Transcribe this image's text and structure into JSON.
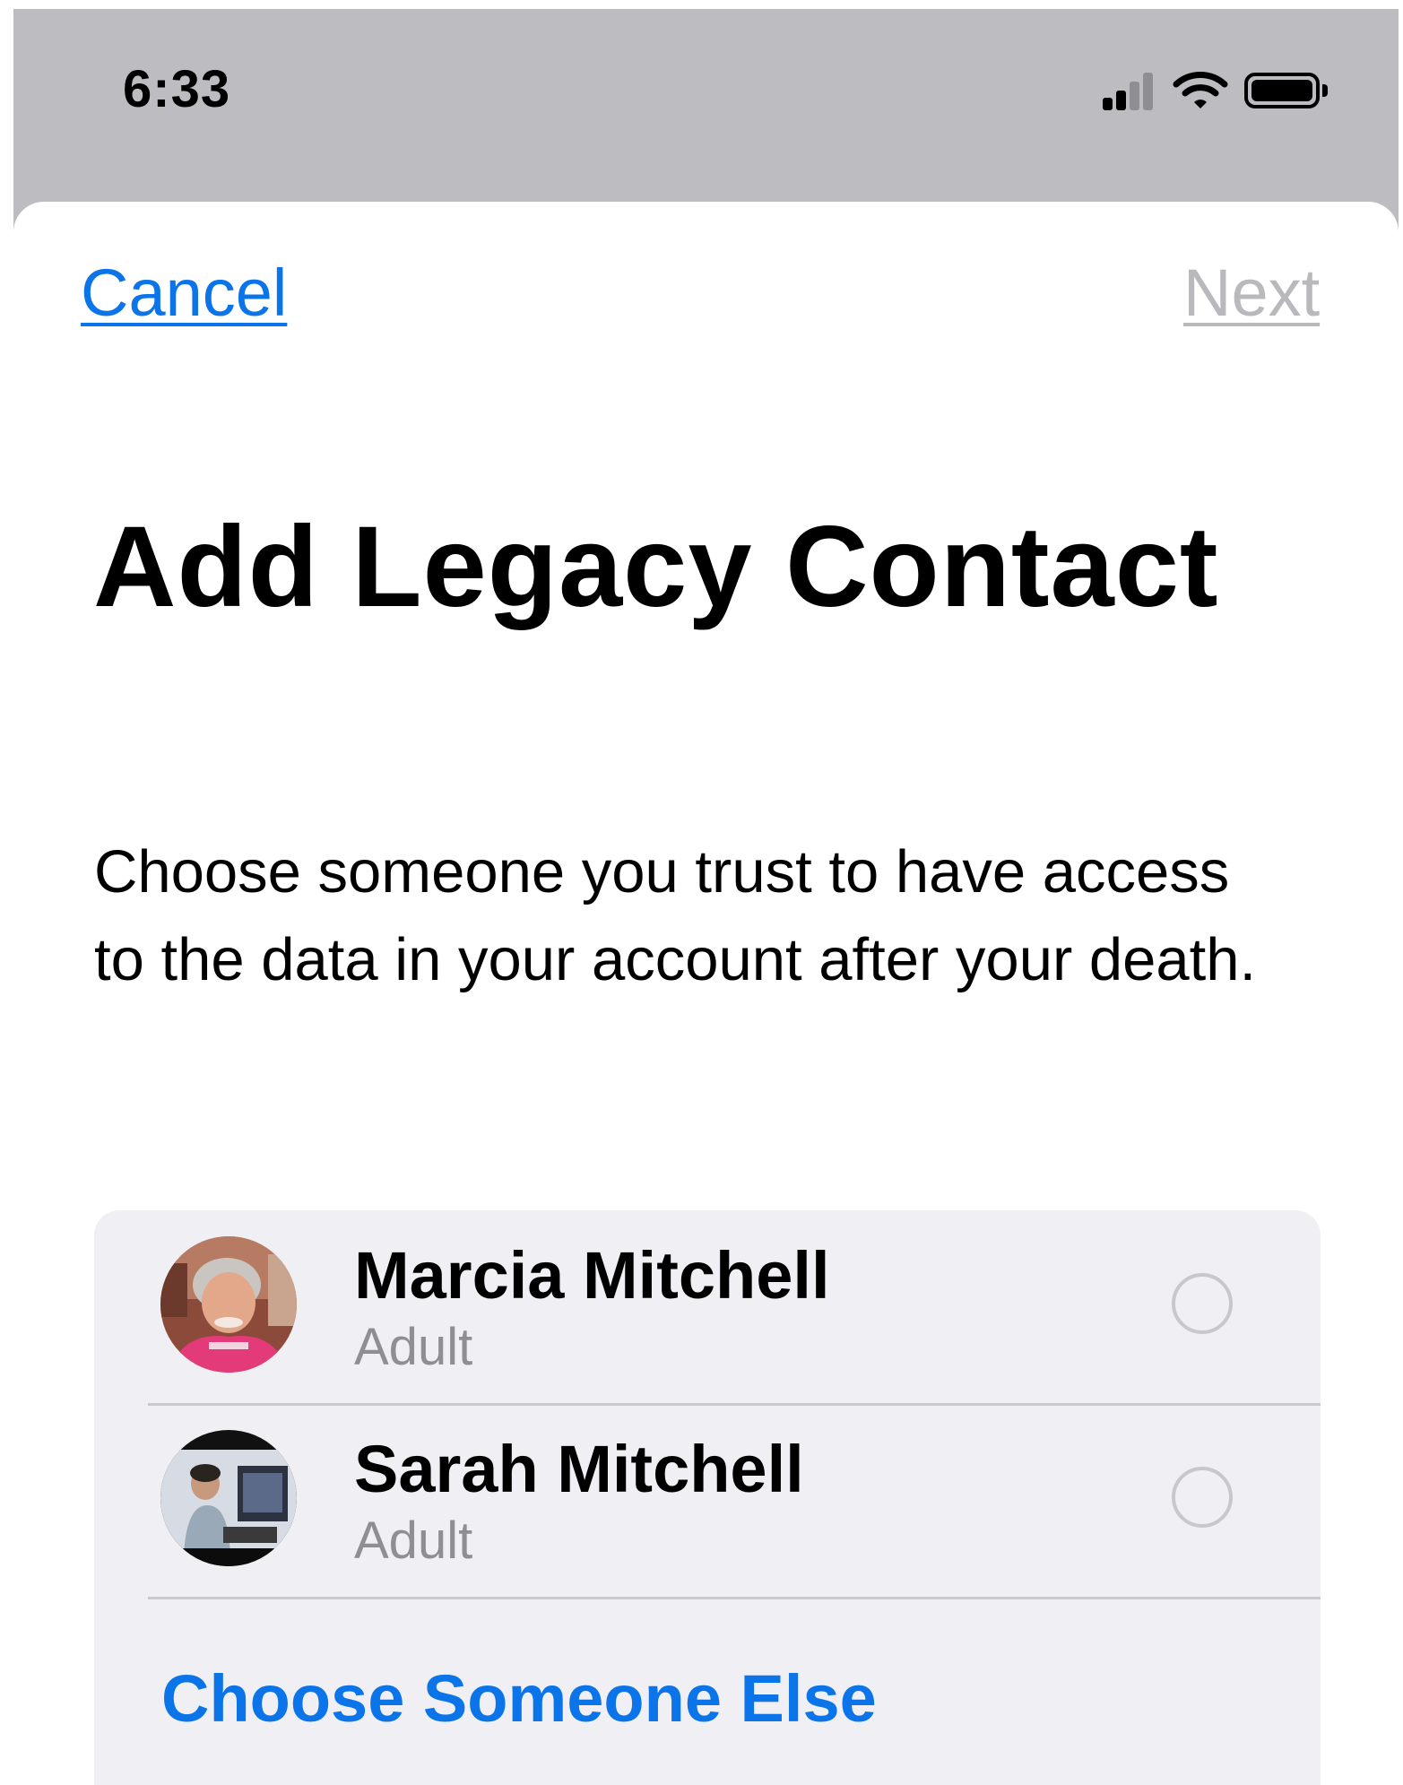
{
  "status_bar": {
    "time": "6:33",
    "icons": [
      "cellular-signal-icon",
      "wifi-icon",
      "battery-icon"
    ]
  },
  "nav": {
    "cancel_label": "Cancel",
    "next_label": "Next"
  },
  "header": {
    "title": "Add Legacy Contact",
    "description": "Choose someone you trust to have access to the data in your account after your death."
  },
  "contacts": [
    {
      "name": "Marcia Mitchell",
      "role": "Adult"
    },
    {
      "name": "Sarah Mitchell",
      "role": "Adult"
    }
  ],
  "choose_someone_else_label": "Choose Someone Else",
  "colors": {
    "accent": "#0a74e8",
    "disabled": "#b9b9bd",
    "card_background": "#efeff4",
    "backdrop": "#bdbcc1"
  }
}
